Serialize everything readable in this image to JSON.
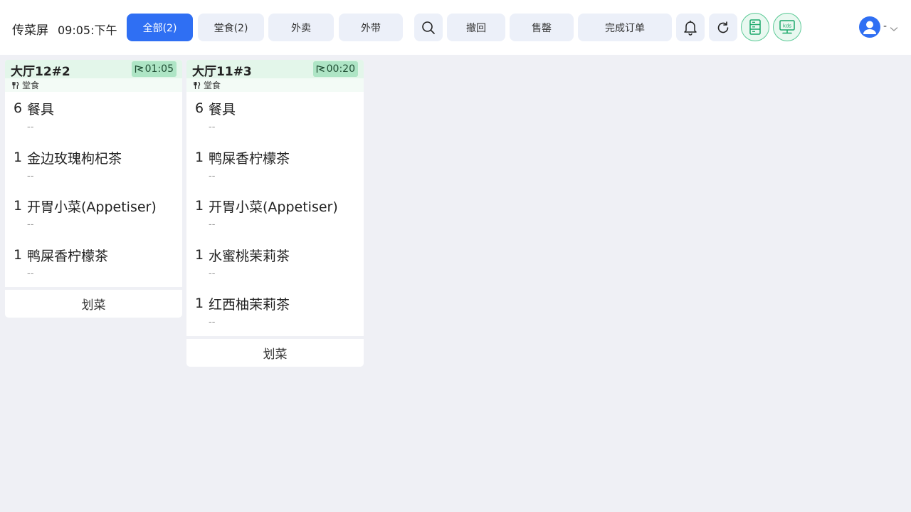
{
  "header": {
    "title": "传菜屏",
    "clock": "09:05:下午",
    "filters": [
      {
        "label": "全部(2)",
        "active": true
      },
      {
        "label": "堂食(2)",
        "active": false
      },
      {
        "label": "外卖",
        "active": false
      },
      {
        "label": "外带",
        "active": false
      }
    ],
    "actions": {
      "search_icon": "search-icon",
      "undo": "撤回",
      "sold_out": "售罄",
      "complete_order": "完成订单",
      "bell_icon": "bell-icon",
      "refresh_icon": "refresh-icon",
      "printer_icon": "printer-icon",
      "kds_label": "kds"
    },
    "user": {
      "name": "-",
      "caret_icon": "chevron-down-icon"
    }
  },
  "colors": {
    "accent": "#2f6ff3",
    "card_header": "#e3f6ea",
    "timer_badge": "#aee5c5",
    "green_outline": "#59c995"
  },
  "orders": [
    {
      "table": "大厅12#2",
      "timer": "01:05",
      "type": "堂食",
      "items": [
        {
          "qty": "6",
          "name": "餐具",
          "note": "--"
        },
        {
          "qty": "1",
          "name": "金边玫瑰枸杞茶",
          "note": "--"
        },
        {
          "qty": "1",
          "name": "开胃小菜(Appetiser)",
          "note": "--"
        },
        {
          "qty": "1",
          "name": "鸭屎香柠檬茶",
          "note": "--"
        }
      ],
      "action": "划菜"
    },
    {
      "table": "大厅11#3",
      "timer": "00:20",
      "type": "堂食",
      "items": [
        {
          "qty": "6",
          "name": "餐具",
          "note": "--"
        },
        {
          "qty": "1",
          "name": "鸭屎香柠檬茶",
          "note": "--"
        },
        {
          "qty": "1",
          "name": "开胃小菜(Appetiser)",
          "note": "--"
        },
        {
          "qty": "1",
          "name": "水蜜桃茉莉茶",
          "note": "--"
        },
        {
          "qty": "1",
          "name": "红西柚茉莉茶",
          "note": "--"
        }
      ],
      "action": "划菜"
    }
  ]
}
